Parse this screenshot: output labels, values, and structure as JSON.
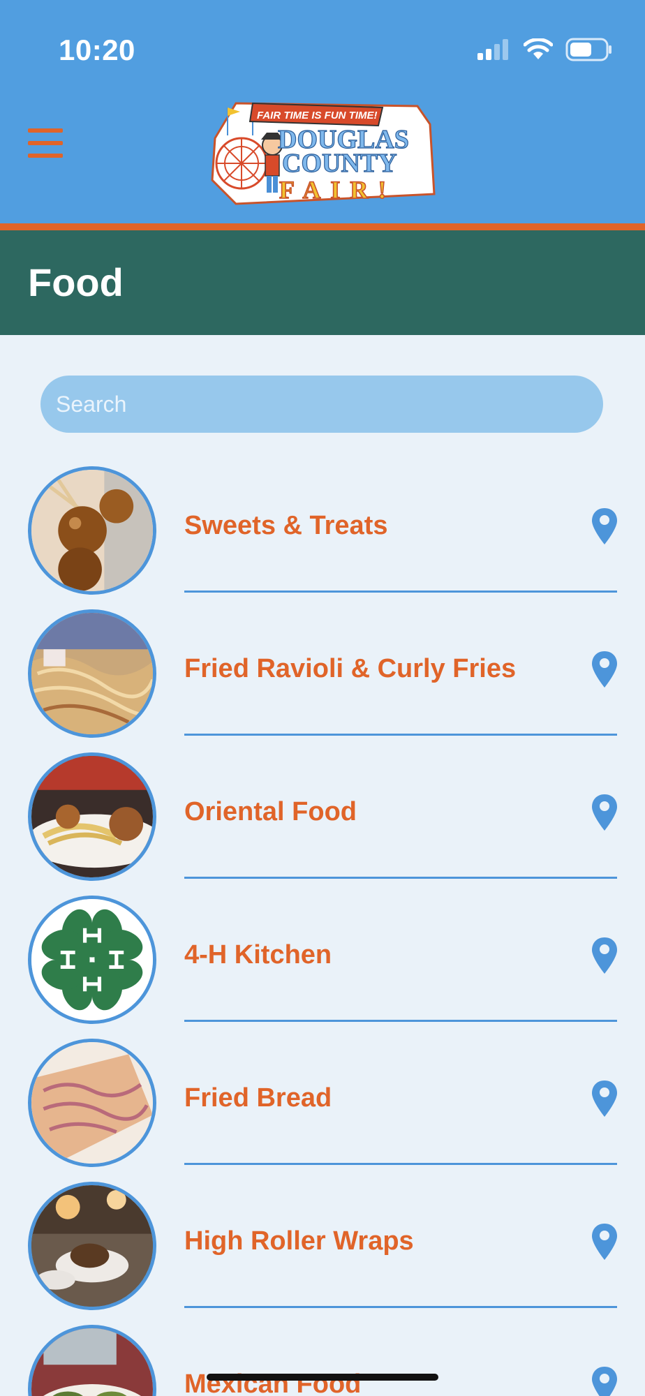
{
  "status_bar": {
    "time": "10:20",
    "icons": [
      "cellular-signal-icon",
      "wifi-icon",
      "battery-icon"
    ]
  },
  "header": {
    "menu_icon": "hamburger-menu-icon",
    "logo": {
      "banner": "FAIR TIME IS FUN TIME!",
      "line1": "DOUGLAS",
      "line2": "COUNTY",
      "line3": "FAIR!"
    }
  },
  "page": {
    "title": "Food"
  },
  "search": {
    "placeholder": "Search",
    "value": ""
  },
  "items": [
    {
      "label": "Sweets & Treats",
      "image": "caramel-apples-photo"
    },
    {
      "label": "Fried Ravioli & Curly Fries",
      "image": "noodles-photo"
    },
    {
      "label": "Oriental Food",
      "image": "lo-mein-plate-photo"
    },
    {
      "label": "4-H Kitchen",
      "image": "4h-clover-logo"
    },
    {
      "label": "Fried Bread",
      "image": "fried-bread-photo"
    },
    {
      "label": "High Roller Wraps",
      "image": "wraps-photo"
    },
    {
      "label": "Mexican Food",
      "image": "tacos-photo"
    }
  ],
  "colors": {
    "header_blue": "#519ee0",
    "accent_orange": "#e06429",
    "title_green": "#2d6860",
    "background": "#eaf2f9",
    "pin_blue": "#4d95da"
  }
}
